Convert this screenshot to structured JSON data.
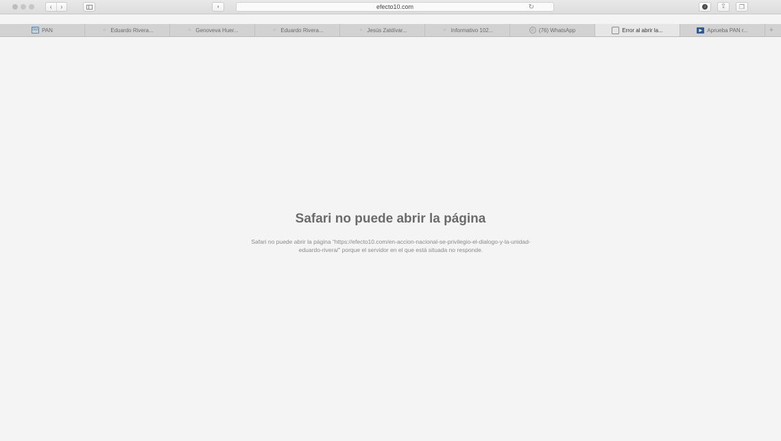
{
  "toolbar": {
    "url": "efecto10.com",
    "icons": {
      "back": "chevron-left-icon",
      "forward": "chevron-right-icon",
      "sidebar": "sidebar-icon",
      "privacy": "shield-icon",
      "reload": "reload-icon",
      "download": "download-icon",
      "share": "share-icon",
      "tabs": "tabs-overview-icon"
    }
  },
  "tabs": [
    {
      "label": "PAN",
      "icon": "pan-favicon-icon",
      "active": false
    },
    {
      "label": "Eduardo Rivera...",
      "icon": "twitter-icon",
      "active": false
    },
    {
      "label": "Genoveva Huer...",
      "icon": "twitter-icon",
      "active": false
    },
    {
      "label": "Eduardo Rivera...",
      "icon": "twitter-icon",
      "active": false
    },
    {
      "label": "Jesús Zaldívar...",
      "icon": "twitter-icon",
      "active": false
    },
    {
      "label": "Informativo 102...",
      "icon": "twitter-icon",
      "active": false
    },
    {
      "label": "(76) WhatsApp",
      "icon": "whatsapp-icon",
      "active": false
    },
    {
      "label": "Error al abrir la...",
      "icon": "error-page-icon",
      "active": true
    },
    {
      "label": "Aprueba PAN r...",
      "icon": "aprueba-favicon-icon",
      "active": false
    }
  ],
  "error": {
    "title": "Safari no puede abrir la página",
    "message": "Safari no puede abrir la página “https://efecto10.com/en-accion-nacional-se-privilegio-el-dialogo-y-la-unidad-eduardo-rivera/” porque el servidor en el que está situada no responde."
  }
}
